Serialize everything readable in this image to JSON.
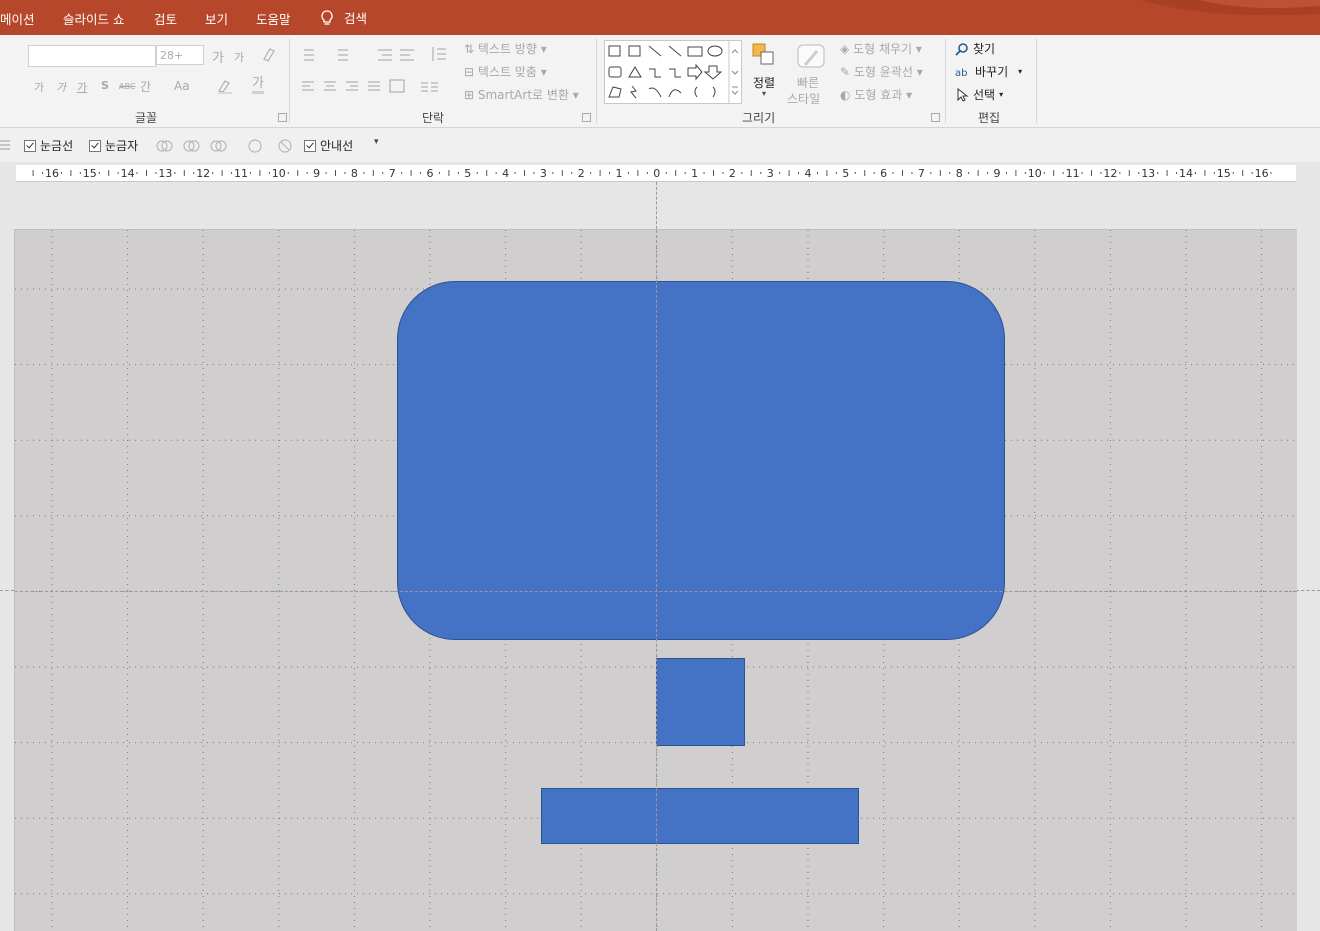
{
  "tabs": {
    "animation": "메이션",
    "slideshow": "슬라이드 쇼",
    "review": "검토",
    "view": "보기",
    "help": "도움말",
    "search": "검색"
  },
  "ribbon": {
    "font_group": {
      "label": "글꼴",
      "size_placeholder": "28+",
      "char_buttons": [
        "가",
        "가",
        "가",
        "S",
        "ABC",
        "간",
        "Aa",
        "가"
      ]
    },
    "paragraph_group": {
      "label": "단락",
      "text_direction": "텍스트 방향",
      "align_text": "텍스트 맞춤",
      "smartart": "SmartArt로 변환"
    },
    "drawing_group": {
      "label": "그리기",
      "arrange": "정렬",
      "quick_styles_1": "빠른",
      "quick_styles_2": "스타일",
      "shape_fill": "도형 채우기",
      "shape_outline": "도형 윤곽선",
      "shape_effects": "도형 효과"
    },
    "editing_group": {
      "label": "편집",
      "find": "찾기",
      "replace": "바꾸기",
      "select": "선택"
    }
  },
  "toolbar": {
    "gridlines": "눈금선",
    "ruler": "눈금자",
    "guides": "안내선"
  },
  "ruler": {
    "labels": [
      "16",
      "15",
      "14",
      "13",
      "12",
      "11",
      "10",
      "9",
      "8",
      "7",
      "6",
      "5",
      "4",
      "3",
      "2",
      "1",
      "0",
      "1",
      "2",
      "3",
      "4",
      "5",
      "6",
      "7",
      "8",
      "9",
      "10",
      "11",
      "12",
      "13",
      "14",
      "15",
      "16"
    ]
  },
  "colors": {
    "accent": "#b7472a",
    "shape_fill": "#4472c4",
    "shape_outline": "#2f528f",
    "slide_bg": "#d0cece"
  }
}
